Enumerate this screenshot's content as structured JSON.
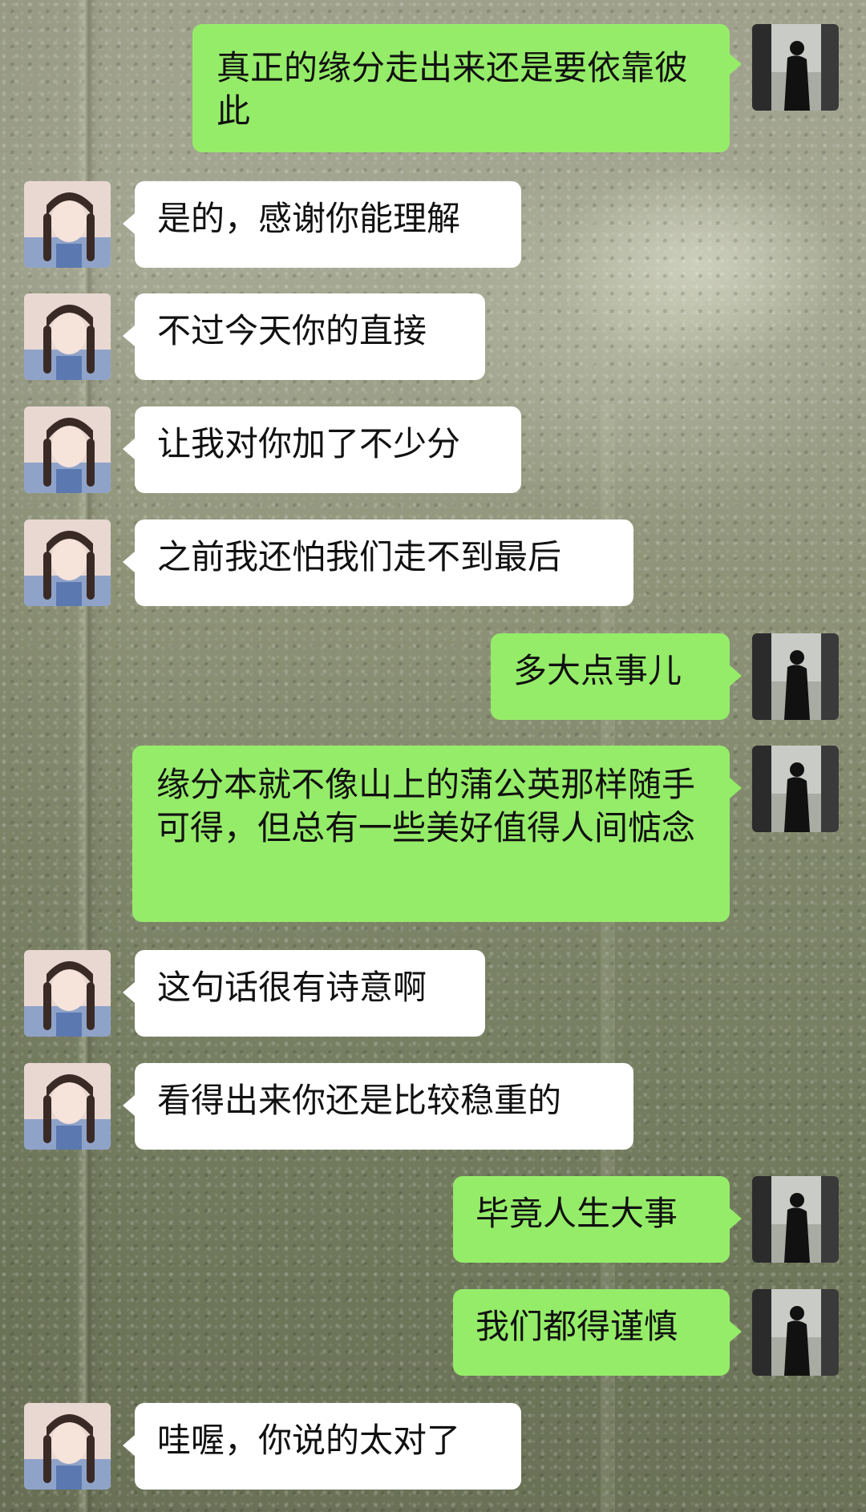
{
  "chat": {
    "messages": [
      {
        "side": "right",
        "text": "真正的缘分走出来还是要依靠彼此"
      },
      {
        "side": "left",
        "text": "是的，感谢你能理解"
      },
      {
        "side": "left",
        "text": "不过今天你的直接"
      },
      {
        "side": "left",
        "text": "让我对你加了不少分"
      },
      {
        "side": "left",
        "text": "之前我还怕我们走不到最后"
      },
      {
        "side": "right",
        "text": "多大点事儿"
      },
      {
        "side": "right",
        "text": "缘分本就不像山上的蒲公英那样随手可得，但总有一些美好值得人间惦念"
      },
      {
        "side": "left",
        "text": "这句话很有诗意啊"
      },
      {
        "side": "left",
        "text": "看得出来你还是比较稳重的"
      },
      {
        "side": "right",
        "text": "毕竟人生大事"
      },
      {
        "side": "right",
        "text": "我们都得谨慎"
      },
      {
        "side": "left",
        "text": "哇喔，你说的太对了"
      }
    ]
  },
  "colors": {
    "incoming_bubble": "#ffffff",
    "outgoing_bubble": "#95ec69"
  },
  "icons": {
    "incoming_avatar": "girl-with-braids-avatar",
    "outgoing_avatar": "silhouette-man-by-window-avatar"
  }
}
